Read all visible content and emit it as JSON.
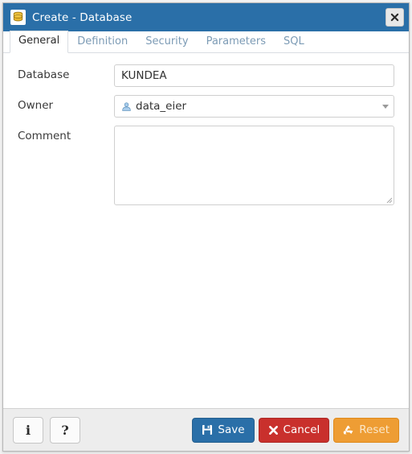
{
  "window": {
    "title": "Create - Database",
    "icon": "database-icon",
    "close_label": "✕",
    "accent_color": "#2a6fa8"
  },
  "tabs": [
    {
      "label": "General",
      "active": true
    },
    {
      "label": "Definition",
      "active": false
    },
    {
      "label": "Security",
      "active": false
    },
    {
      "label": "Parameters",
      "active": false
    },
    {
      "label": "SQL",
      "active": false
    }
  ],
  "form": {
    "database": {
      "label": "Database",
      "value": "KUNDEA",
      "placeholder": ""
    },
    "owner": {
      "label": "Owner",
      "value": "data_eier",
      "icon": "user-icon",
      "caret": "chevron-down-icon"
    },
    "comment": {
      "label": "Comment",
      "value": "",
      "placeholder": ""
    }
  },
  "footer": {
    "info_label": "i",
    "help_label": "?",
    "save_label": "Save",
    "cancel_label": "Cancel",
    "reset_label": "Reset",
    "save_color": "#2a6fa8",
    "cancel_color": "#c9302c",
    "reset_color": "#ee9d34"
  }
}
